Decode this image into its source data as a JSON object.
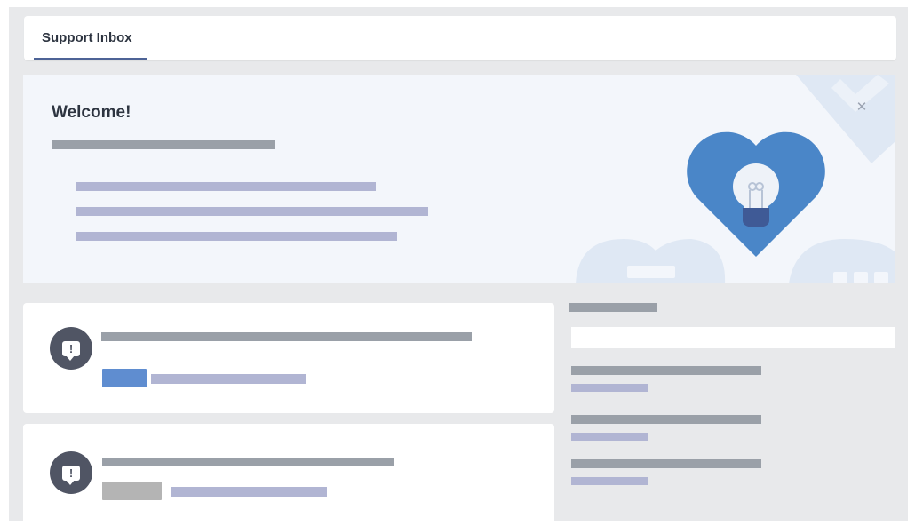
{
  "tabs": [
    {
      "label": "Support Inbox",
      "active": true
    }
  ],
  "banner": {
    "title": "Welcome!",
    "close_glyph": "✕",
    "illustration": "heart-lightbulb-icon"
  },
  "cards": [
    {
      "icon": "alert-message-icon",
      "tag_color": "#5f8dd0"
    },
    {
      "icon": "alert-message-icon",
      "tag_color": "#b4b4b4"
    }
  ],
  "alert_glyph": "!",
  "sidebar": {
    "search": {
      "value": "",
      "placeholder": ""
    },
    "items_count_visible": 3
  },
  "colors": {
    "accent": "#4d6396",
    "heart": "#4a86c8",
    "alert_icon_bg": "#505564",
    "text_placeholder_grey": "#9aa0a8",
    "text_placeholder_lavender": "#b1b5d3",
    "background": "#e8e9eb"
  }
}
